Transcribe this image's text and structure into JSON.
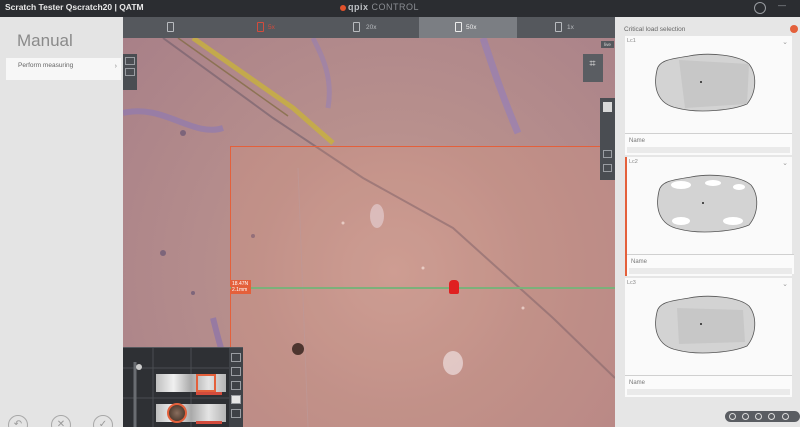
{
  "titlebar": {
    "app_title": "Scratch Tester Qscratch20 | QATM",
    "brand_mark": "qpix",
    "brand_text": "CONTROL",
    "minimize": "—"
  },
  "left_panel": {
    "heading": "Manual",
    "menu": [
      {
        "label": "Perform measuring",
        "chevron": "›"
      }
    ],
    "footer_buttons": [
      {
        "icon": "undo-icon",
        "glyph": "↶"
      },
      {
        "icon": "close-icon",
        "glyph": "✕"
      },
      {
        "icon": "check-icon",
        "glyph": "✓"
      }
    ]
  },
  "magnification_tabs": [
    {
      "label": "",
      "icon": "camera-icon",
      "active": false,
      "red": false
    },
    {
      "label": "5x",
      "icon": "lens-icon",
      "active": false,
      "red": true
    },
    {
      "label": "20x",
      "icon": "lens-icon",
      "active": false,
      "red": false
    },
    {
      "label": "50x",
      "icon": "lens-icon",
      "active": true,
      "red": false
    },
    {
      "label": "1x",
      "icon": "lens-icon",
      "active": false,
      "red": false
    }
  ],
  "viewer": {
    "camera_tag": "live",
    "measurement": {
      "line1": "18.47N",
      "line2": "2.1mm"
    }
  },
  "right_panel": {
    "title": "Critical load selection",
    "cards": [
      {
        "label": "Lc1",
        "name_label": "Name",
        "active": false
      },
      {
        "label": "Lc2",
        "name_label": "Name",
        "active": true
      },
      {
        "label": "Lc3",
        "name_label": "Name",
        "active": false
      }
    ]
  },
  "colors": {
    "accent": "#e4603b",
    "marker": "#e02020",
    "guide": "#7cb07a"
  }
}
